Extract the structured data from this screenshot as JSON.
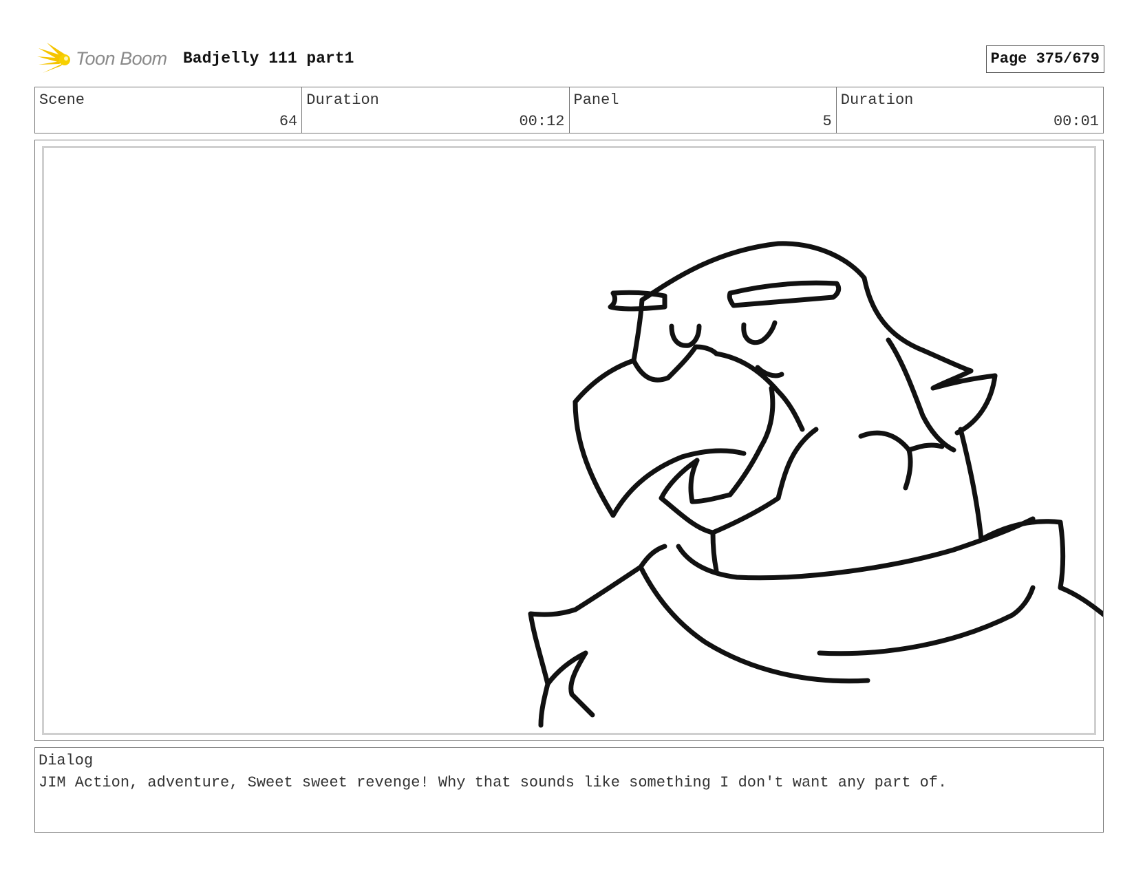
{
  "header": {
    "logo_text": "Toon Boom",
    "project_title": "Badjelly 111 part1",
    "page_label": "Page 375/679"
  },
  "info": {
    "scene_label": "Scene",
    "scene_value": "64",
    "scene_duration_label": "Duration",
    "scene_duration_value": "00:12",
    "panel_label": "Panel",
    "panel_value": "5",
    "panel_duration_label": "Duration",
    "panel_duration_value": "00:01"
  },
  "dialog": {
    "label": "Dialog",
    "text": "JIM Action, adventure, Sweet sweet revenge! Why that sounds like something I don't want any part of."
  },
  "colors": {
    "logo_accent": "#f5c400",
    "ink": "#111111",
    "border": "#777777"
  }
}
